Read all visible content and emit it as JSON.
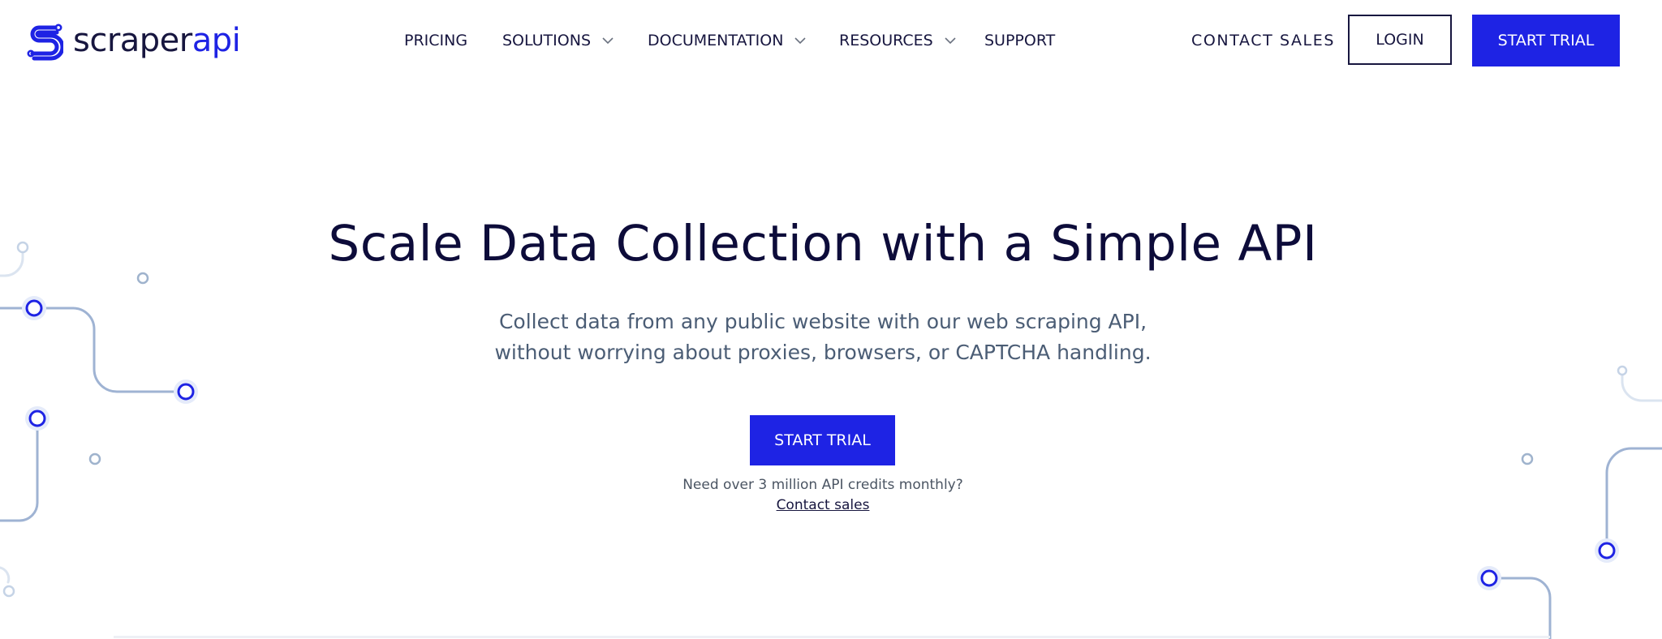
{
  "brand": {
    "name_part1": "scraper",
    "name_part2": "api",
    "logo_icon": "scraperapi-s-logo-icon",
    "primary_color": "#1e23e4",
    "text_color": "#17163f"
  },
  "nav": {
    "items": [
      {
        "label": "PRICING",
        "has_dropdown": false
      },
      {
        "label": "SOLUTIONS",
        "has_dropdown": true
      },
      {
        "label": "DOCUMENTATION",
        "has_dropdown": true
      },
      {
        "label": "RESOURCES",
        "has_dropdown": true
      },
      {
        "label": "SUPPORT",
        "has_dropdown": false
      }
    ],
    "contact_sales": "CONTACT SALES",
    "login": "LOGIN",
    "start_trial": "START TRIAL"
  },
  "hero": {
    "title": "Scale Data Collection with a Simple API",
    "subtitle_line1": "Collect data from any public website with our web scraping API,",
    "subtitle_line2": "without worrying about proxies, browsers, or CAPTCHA handling.",
    "cta_label": "START TRIAL",
    "credits_note": "Need over 3 million API credits monthly?",
    "contact_link": "Contact sales"
  }
}
